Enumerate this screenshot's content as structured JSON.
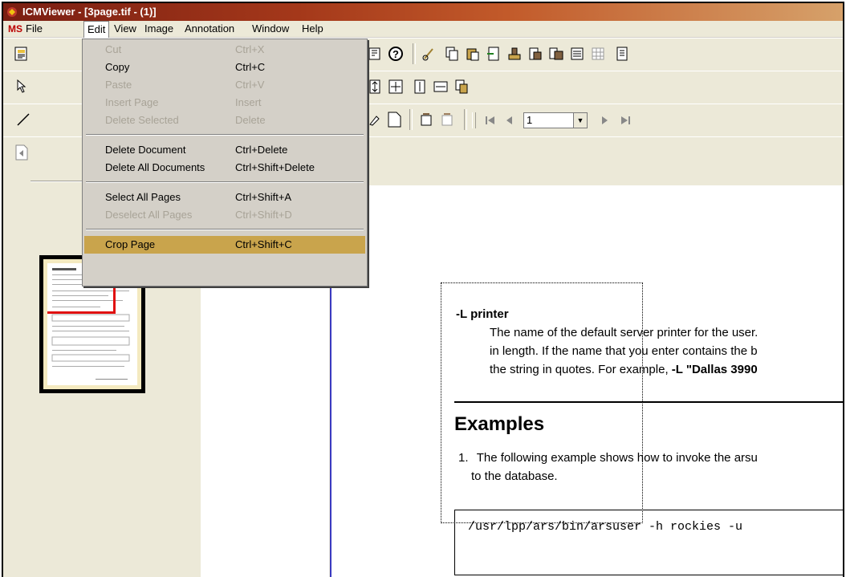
{
  "window": {
    "title": "ICMViewer - [3page.tif - (1)]"
  },
  "menubar": {
    "logo": "MS",
    "items": [
      {
        "label": "File"
      },
      {
        "label": "Edit"
      },
      {
        "label": "View"
      },
      {
        "label": "Image"
      },
      {
        "label": "Annotation"
      },
      {
        "label": "Window"
      },
      {
        "label": "Help"
      }
    ]
  },
  "edit_menu": {
    "items": [
      {
        "label": "Cut",
        "shortcut": "Ctrl+X",
        "enabled": false
      },
      {
        "label": "Copy",
        "shortcut": "Ctrl+C",
        "enabled": true
      },
      {
        "label": "Paste",
        "shortcut": "Ctrl+V",
        "enabled": false
      },
      {
        "label": "Insert Page",
        "shortcut": "Insert",
        "enabled": false
      },
      {
        "label": "Delete Selected",
        "shortcut": "Delete",
        "enabled": false
      },
      {
        "label": "Delete Document",
        "shortcut": "Ctrl+Delete",
        "enabled": true
      },
      {
        "label": "Delete All Documents",
        "shortcut": "Ctrl+Shift+Delete",
        "enabled": true
      },
      {
        "label": "Select All Pages",
        "shortcut": "Ctrl+Shift+A",
        "enabled": true
      },
      {
        "label": "Deselect All Pages",
        "shortcut": "Ctrl+Shift+D",
        "enabled": false
      },
      {
        "label": "Crop Page",
        "shortcut": "Ctrl+Shift+C",
        "enabled": true,
        "highlighted": true
      }
    ]
  },
  "page_nav": {
    "page_value": "1"
  },
  "document": {
    "option_flag": "-L",
    "option_name": "printer",
    "option_desc_1": "The name of the default server printer for the user.",
    "option_desc_2": "in length. If the name that you enter contains the b",
    "option_desc_3_prefix": "the string in quotes. For example, ",
    "option_desc_3_bold": "-L \"Dallas 3990",
    "heading": "Examples",
    "example_num": "1.",
    "example_line_1": "The following example shows how to invoke the arsu",
    "example_line_2": "to the database.",
    "code": "/usr/lpp/ars/bin/arsuser -h rockies -u"
  },
  "colors": {
    "highlight": "#c9a44c",
    "title_start": "#7a1e12",
    "crop_rect": "#e01010"
  }
}
